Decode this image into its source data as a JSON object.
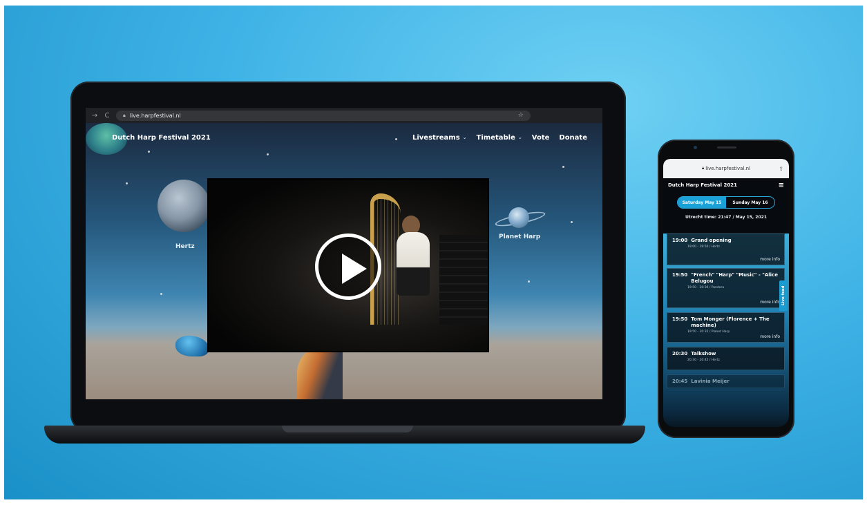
{
  "browser": {
    "url": "live.harpfestival.nl"
  },
  "site": {
    "brand": "Dutch Harp Festival 2021",
    "menu": [
      {
        "label": "Livestreams",
        "has_dropdown": true
      },
      {
        "label": "Timetable",
        "has_dropdown": true
      },
      {
        "label": "Vote",
        "has_dropdown": false
      },
      {
        "label": "Donate",
        "has_dropdown": false
      }
    ],
    "planets": {
      "left_label": "Hertz",
      "right_label": "Planet Harp"
    }
  },
  "phone": {
    "url": "live.harpfestival.nl",
    "brand": "Dutch Harp Festival 2021",
    "days": [
      "Saturday May 15",
      "Sunday May 16"
    ],
    "active_day": 0,
    "utrecht_time": "Utrecht time: 21:47 / May 15, 2021",
    "live_feed_label": "Live feed",
    "events": [
      {
        "time": "19:00",
        "title": "Grand opening",
        "sub": "19:00 - 19:50 / Hertz",
        "more": "more info"
      },
      {
        "time": "19:50",
        "title": "\"French\" \"Harp\" \"Music\" - \"Alice Belugou",
        "sub": "19:50 - 20:30 / Pandora",
        "more": "more info"
      },
      {
        "time": "19:50",
        "title": "Tom Monger (Florence + The machine)",
        "sub": "19:50 - 20:35 / Planet Harp",
        "more": "more info"
      },
      {
        "time": "20:30",
        "title": "Talkshow",
        "sub": "20:30 - 20:45 / Hertz",
        "more": ""
      },
      {
        "time": "20:45",
        "title": "Lavinia Meijer",
        "sub": "",
        "more": ""
      }
    ]
  },
  "colors": {
    "background": "#3fb3e6",
    "accent": "#19a1d8"
  },
  "icons": [
    "back-arrow-icon",
    "reload-icon",
    "lock-icon",
    "star-icon",
    "chevron-down-icon",
    "play-icon",
    "share-icon",
    "hamburger-icon"
  ]
}
